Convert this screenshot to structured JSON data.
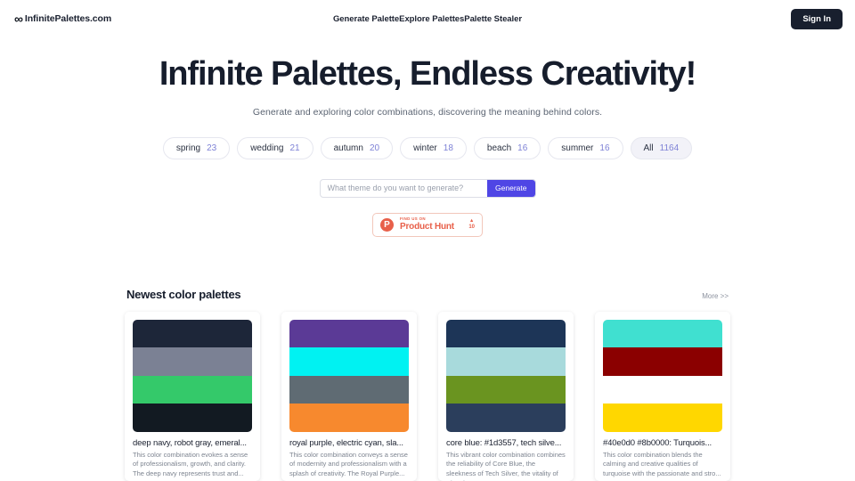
{
  "header": {
    "logo_mark": "∞",
    "logo_text": "InfinitePalettes.com",
    "nav": [
      {
        "label": "Generate Palette"
      },
      {
        "label": "Explore Palettes"
      },
      {
        "label": "Palette Stealer"
      }
    ],
    "signin_label": "Sign In"
  },
  "hero": {
    "title": "Infinite Palettes, Endless Creativity!",
    "subtitle": "Generate and exploring color combinations, discovering the meaning behind colors."
  },
  "tags": [
    {
      "label": "spring",
      "count": "23",
      "active": false
    },
    {
      "label": "wedding",
      "count": "21",
      "active": false
    },
    {
      "label": "autumn",
      "count": "20",
      "active": false
    },
    {
      "label": "winter",
      "count": "18",
      "active": false
    },
    {
      "label": "beach",
      "count": "16",
      "active": false
    },
    {
      "label": "summer",
      "count": "16",
      "active": false
    },
    {
      "label": "All",
      "count": "1164",
      "active": true
    }
  ],
  "search": {
    "placeholder": "What theme do you want to generate?",
    "value": "",
    "button_label": "Generate"
  },
  "product_hunt": {
    "small_text": "FIND US ON",
    "big_text": "Product Hunt",
    "mark": "P",
    "arrow": "▲",
    "votes": "10",
    "accent": "#e8604a"
  },
  "section": {
    "title": "Newest color palettes",
    "more_label": "More >>"
  },
  "palettes": [
    {
      "title": "deep navy, robot gray, emeral...",
      "description": "This color combination evokes a sense of professionalism, growth, and clarity. The deep navy represents trust and...",
      "colors": [
        "#1d2639",
        "#7b8194",
        "#34c96a",
        "#121a22"
      ]
    },
    {
      "title": "royal purple, electric cyan, sla...",
      "description": "This color combination conveys a sense of modernity and professionalism with a splash of creativity. The Royal Purple...",
      "colors": [
        "#5b3a96",
        "#00f2f2",
        "#5f6b73",
        "#f7892e"
      ]
    },
    {
      "title": "core blue: #1d3557, tech silve...",
      "description": "This vibrant color combination combines the reliability of Core Blue, the sleekness of Tech Silver, the vitality of Electric...",
      "colors": [
        "#1d3557",
        "#a8dadc",
        "#6a9420",
        "#2b3e5c"
      ]
    },
    {
      "title": "#40e0d0 #8b0000: Turquois...",
      "description": "This color combination blends the calming and creative qualities of turquoise with the passionate and stro...",
      "colors": [
        "#40e0d0",
        "#8b0000",
        "#ffffff",
        "#ffd700"
      ]
    }
  ]
}
